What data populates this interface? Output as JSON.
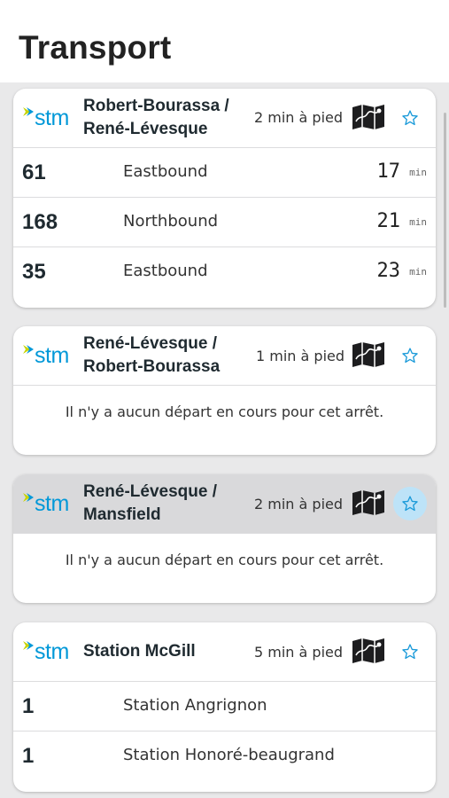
{
  "header": {
    "title": "Transport"
  },
  "cards": [
    {
      "logo": "stm",
      "stop_name": "Robert-Bourassa / René-Lévesque",
      "walk": "2 min à pied",
      "departures": [
        {
          "route": "61",
          "direction": "Eastbound",
          "minutes": "17",
          "unit": "min"
        },
        {
          "route": "168",
          "direction": "Northbound",
          "minutes": "21",
          "unit": "min"
        },
        {
          "route": "35",
          "direction": "Eastbound",
          "minutes": "23",
          "unit": "min"
        }
      ]
    },
    {
      "logo": "stm",
      "stop_name": "René-Lévesque / Robert-Bourassa",
      "walk": "1 min à pied",
      "message": "Il n'y a aucun départ en cours pour cet arrêt."
    },
    {
      "logo": "stm",
      "stop_name": "René-Lévesque / Mansfield",
      "walk": "2 min à pied",
      "message": "Il n'y a aucun départ en cours pour cet arrêt.",
      "favorite": true
    },
    {
      "logo": "stm",
      "stop_name": "Station McGill",
      "walk": "5 min à pied",
      "departures": [
        {
          "route": "1",
          "direction": "Station Angrignon"
        },
        {
          "route": "1",
          "direction": "Station Honoré-beaugrand"
        }
      ]
    }
  ],
  "colors": {
    "accent": "#0098d8",
    "logo_chevron": "#c7d300",
    "favorite_bg": "#bde3f8"
  },
  "icons": {
    "map": "map-icon",
    "favorite": "star-icon"
  }
}
